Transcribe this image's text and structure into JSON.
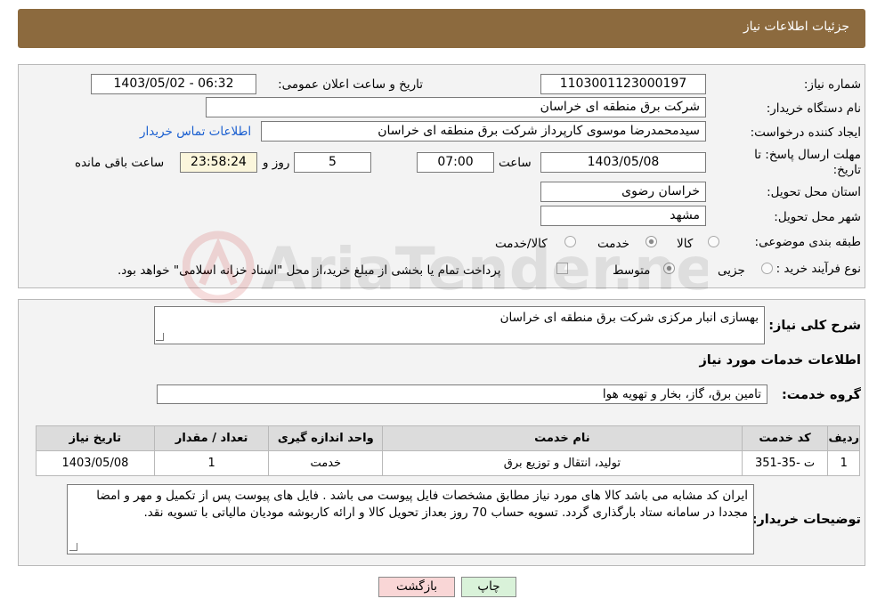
{
  "header": {
    "title": "جزئیات اطلاعات نیاز"
  },
  "form": {
    "need_number_label": "شماره نیاز:",
    "need_number": "1103001123000197",
    "announce_label": "تاریخ و ساعت اعلان عمومی:",
    "announce_value": "1403/05/02 - 06:32",
    "buyer_org_label": "نام دستگاه خریدار:",
    "buyer_org": "شرکت برق منطقه ای خراسان",
    "creator_label": "ایجاد کننده درخواست:",
    "creator": "سیدمحمدرضا موسوی کارپرداز شرکت برق منطقه ای خراسان",
    "contact_link": "اطلاعات تماس خریدار",
    "deadline_label_1": "مهلت ارسال پاسخ: تا",
    "deadline_label_2": "تاریخ:",
    "deadline_date": "1403/05/08",
    "time_label": "ساعت",
    "deadline_time": "07:00",
    "days_value": "5",
    "days_label": "روز و",
    "remaining_time": "23:58:24",
    "remaining_label": "ساعت باقی مانده",
    "province_label": "استان محل تحویل:",
    "province": "خراسان رضوی",
    "city_label": "شهر محل تحویل:",
    "city": "مشهد",
    "category_label": "طبقه بندی موضوعی:",
    "category_options": [
      "کالا",
      "خدمت",
      "کالا/خدمت"
    ],
    "category_selected": "خدمت",
    "process_label": "نوع فرآیند خرید :",
    "process_options": [
      "جزیی",
      "متوسط"
    ],
    "process_selected": "متوسط",
    "treasury_note": "پرداخت تمام یا بخشی از مبلغ خرید،از محل \"اسناد خزانه اسلامی\" خواهد بود."
  },
  "details": {
    "summary_label": "شرح کلی نیاز:",
    "summary": "بهسازی انبار مرکزی شرکت برق منطقه ای خراسان",
    "services_title": "اطلاعات خدمات مورد نیاز",
    "service_group_label": "گروه خدمت:",
    "service_group": "تامین برق، گاز، بخار و تهویه هوا",
    "table": {
      "headers": [
        "ردیف",
        "کد خدمت",
        "نام خدمت",
        "واحد اندازه گیری",
        "تعداد / مقدار",
        "تاریخ نیاز"
      ],
      "rows": [
        [
          "1",
          "ت -35-351",
          "تولید، انتقال و توزیع برق",
          "خدمت",
          "1",
          "1403/05/08"
        ]
      ]
    },
    "buyer_notes_label": "توضیحات خریدار:",
    "buyer_notes": "ایران کد مشابه می باشد کالا های مورد نیاز مطابق مشخصات فایل پیوست می باشد . فایل های پیوست پس از تکمیل و مهر و امضا مجددا در سامانه ستاد بارگذاری گردد. تسویه حساب 70 روز بعداز تحویل کالا و ارائه کاربوشه مودیان مالیاتی با تسویه نقد."
  },
  "buttons": {
    "print": "چاپ",
    "back": "بازگشت"
  },
  "watermark": {
    "text": "AriaTender.neT"
  },
  "colors": {
    "header": "#8c6a3e",
    "link": "#1a5fd0",
    "back_button": "#f9d6d6",
    "print_button": "#d9f2d9"
  }
}
